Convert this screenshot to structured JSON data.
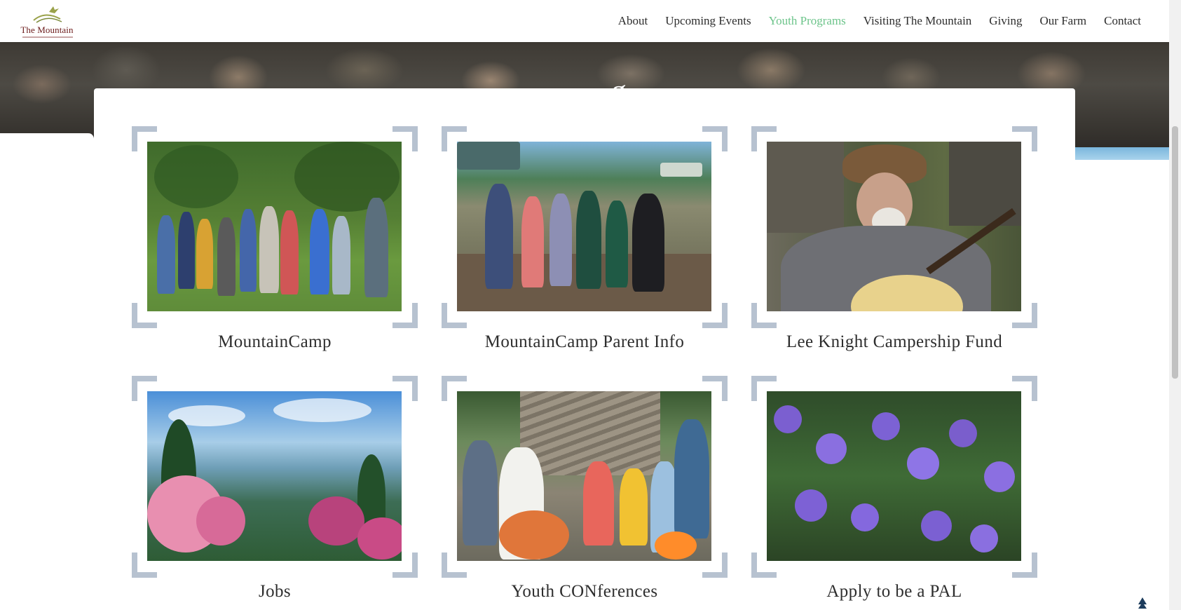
{
  "header": {
    "logo_text": "The Mountain",
    "logo_icon": "bird-over-mountain-logo",
    "nav": [
      {
        "label": "About",
        "active": false
      },
      {
        "label": "Upcoming Events",
        "active": false
      },
      {
        "label": "Youth Programs",
        "active": true
      },
      {
        "label": "Visiting The Mountain",
        "active": false
      },
      {
        "label": "Giving",
        "active": false
      },
      {
        "label": "Our Farm",
        "active": false
      },
      {
        "label": "Contact",
        "active": false
      }
    ]
  },
  "hero": {
    "title_fragment": "g"
  },
  "programs": [
    {
      "title": "MountainCamp",
      "photo": "group-of-campers-with-vegetables"
    },
    {
      "title": "MountainCamp Parent Info",
      "photo": "campers-on-river-deck"
    },
    {
      "title": "Lee Knight Campership Fund",
      "photo": "man-with-guitar"
    },
    {
      "title": "Jobs",
      "photo": "mountain-vista-with-rhododendron"
    },
    {
      "title": "Youth CONferences",
      "photo": "teens-around-campfire-with-guitar"
    },
    {
      "title": "Apply to be a PAL",
      "photo": "purple-bellflowers"
    }
  ],
  "colors": {
    "nav_active": "#6cc48a",
    "logo": "#6b1a1a",
    "frame_corner": "#b7c2d0"
  }
}
